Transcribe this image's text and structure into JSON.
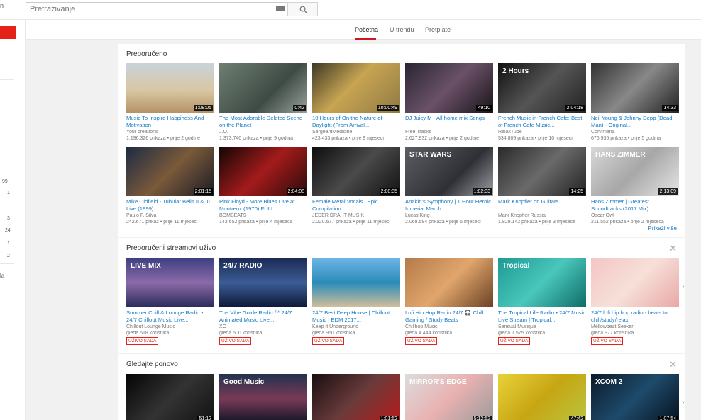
{
  "header": {
    "sidebar_snip": "n",
    "search_placeholder": "Pretraživanje"
  },
  "sidebar": {
    "numbers": [
      "99+",
      "1",
      "3",
      "24",
      "1",
      "2"
    ],
    "label_snip": "la"
  },
  "tabs": [
    {
      "label": "Početna",
      "active": true
    },
    {
      "label": "U trendu",
      "active": false
    },
    {
      "label": "Pretplate",
      "active": false
    }
  ],
  "sections": {
    "recommended": {
      "title": "Preporučeno",
      "more_label": "Prikaži više",
      "videos": [
        {
          "title": "Music To Inspire Happiness And Motivation",
          "channel": "Your creations",
          "meta": "1.196.326 prikaza • prije 2 godine",
          "duration": "1:08:05"
        },
        {
          "title": "The Most Adorable Deleted Scene on the Planet",
          "channel": "J.O.",
          "meta": "1.373.740 prikaza • prije 9 godina",
          "duration": "0:42"
        },
        {
          "title": "10 Hours of On the Nature of Daylight (From Arrival...",
          "channel": "SergeantMedicine",
          "meta": "423.433 prikaza • prije 9 mjeseci",
          "duration": "10:00:49"
        },
        {
          "title": "DJ Juicy M - All home mix Songs",
          "channel": "Free Tracks",
          "meta": "2.627.932 prikaza • prije 2 godine",
          "duration": "49:10"
        },
        {
          "title": "French Music in French Cafe: Best of French Cafe Music...",
          "channel": "RelaxTube",
          "meta": "534.809 prikaza • prije 10 mjeseci",
          "duration": "2:04:18",
          "thumb_text": "2 Hours"
        },
        {
          "title": "Neil Young & Johnny Depp (Dead Man) - Original...",
          "channel": "Corviniana",
          "meta": "676.935 prikaza • prije 5 godina",
          "duration": "14:33"
        },
        {
          "title": "Mike Oldfield - Tubular Bells II & III Live (1999)",
          "channel": "Paulo F. Silva",
          "meta": "242.671 prikaz • prije 11 mjeseci",
          "duration": "2:01:15"
        },
        {
          "title": "Pink Floyd - More Blues Live at Montreux (1970) FULL...",
          "channel": "BOMBEATS",
          "meta": "143.652 prikaza • prije 4 mjeseca",
          "duration": "2:04:08"
        },
        {
          "title": "Female Metal Vocals | Epic Compilation",
          "channel": "JEDER DRAHT MUSIK",
          "meta": "2.220.577 prikaza • prije 11 mjeseci",
          "duration": "2:00:35"
        },
        {
          "title": "Anakin's Symphony | 1 Hour Heroic Imperial March",
          "channel": "Lucas King",
          "meta": "2.068.584 prikaza • prije 6 mjeseci",
          "duration": "1:02:33",
          "thumb_text": "STAR WARS"
        },
        {
          "title": "Mark Knopfler on Guitars",
          "channel": "Mark Knopfler Russia",
          "meta": "1.829.142 prikaza • prije 3 mjeseca",
          "duration": "14:25"
        },
        {
          "title": "Hans Zimmer | Greatest Soundtracks (2017 Mix)",
          "channel": "Oscar Owl",
          "meta": "211.552 prikaza • prije 2 mjeseca",
          "duration": "2:13:09",
          "thumb_text": "HANS ZIMMER"
        }
      ]
    },
    "live": {
      "title": "Preporučeni streamovi uživo",
      "close_label": "✕",
      "videos": [
        {
          "title": "Summer Chill & Lounge Radio • 24/7 Chillout Music Live...",
          "channel": "Chillout Lounge Music",
          "meta": "gleda 518 korisnika",
          "badge": "UŽIVO SADA",
          "thumb_text": "LIVE MIX"
        },
        {
          "title": "The Vibe Guide Radio ™ 24/7 Animated Music Live...",
          "channel": "XO",
          "meta": "gleda 500 korisnika",
          "badge": "UŽIVO SADA",
          "thumb_text": "24/7 RADIO"
        },
        {
          "title": "24/7 Best Deep House | Chillout Music | EDM 2017...",
          "channel": "Keep It Underground",
          "meta": "gleda 950 korisnika",
          "badge": "UŽIVO SADA"
        },
        {
          "title": "Lofi Hip Hop Radio 24/7 🎧 Chill Gaming / Study Beats",
          "channel": "Chillhop Music",
          "meta": "gleda 4.444 korisnika",
          "badge": "UŽIVO SADA"
        },
        {
          "title": "The Tropical Life Radio • 24/7 Music Live Stream | Tropical...",
          "channel": "Sensual Musique",
          "meta": "gleda 1.575 korisnika",
          "badge": "UŽIVO SADA",
          "thumb_text": "Tropical"
        },
        {
          "title": "24/7 lofi hip hop radio - beats to chill/study/relax",
          "channel": "Mellowbeat Seeker",
          "meta": "gleda 977 korisnika",
          "badge": "UŽIVO SADA"
        }
      ]
    },
    "watch_again": {
      "title": "Gledajte ponovo",
      "close_label": "✕",
      "videos": [
        {
          "duration": "51:12"
        },
        {
          "duration": "",
          "thumb_text": "Good Music"
        },
        {
          "duration": "1:01:52"
        },
        {
          "duration": "5:12:52",
          "thumb_text": "MIRROR'S EDGE"
        },
        {
          "duration": "47:42"
        },
        {
          "duration": "1:07:54",
          "thumb_text": "XCOM 2"
        }
      ]
    }
  },
  "colors": {
    "accent": "#cc181e",
    "live_red": "#e62117",
    "link": "#167ac6"
  }
}
